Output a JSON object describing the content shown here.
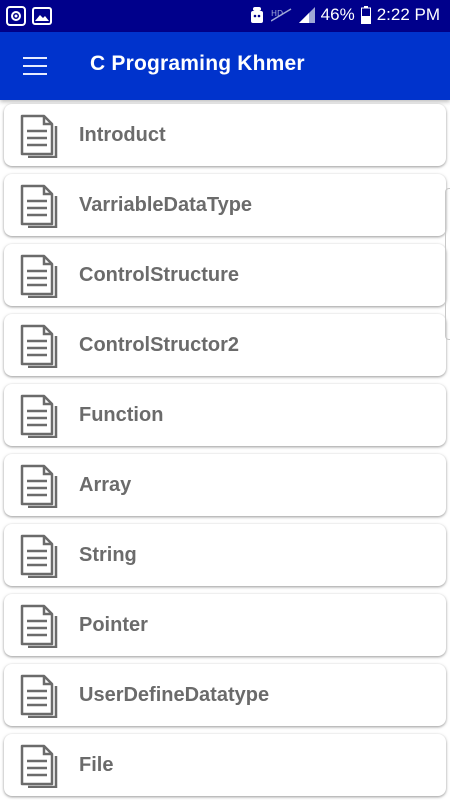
{
  "status_bar": {
    "battery": "46%",
    "time": "2:22 PM",
    "icons": [
      "gallery-icon",
      "image-icon",
      "android-icon",
      "signal-off-icon",
      "signal-icon",
      "battery-icon"
    ]
  },
  "app_bar": {
    "title": "C Programing Khmer",
    "menu_icon": "hamburger-menu-icon"
  },
  "colors": {
    "status_bar": "#00008b",
    "app_bar": "#0033cc",
    "label_text": "#6b6b6b",
    "icon": "#6b6b6b"
  },
  "items": [
    {
      "label": "Introduct",
      "icon": "document-icon"
    },
    {
      "label": "VarriableDataType",
      "icon": "document-icon"
    },
    {
      "label": "ControlStructure",
      "icon": "document-icon"
    },
    {
      "label": "ControlStructor2",
      "icon": "document-icon"
    },
    {
      "label": "Function",
      "icon": "document-icon"
    },
    {
      "label": "Array",
      "icon": "document-icon"
    },
    {
      "label": "String",
      "icon": "document-icon"
    },
    {
      "label": "Pointer",
      "icon": "document-icon"
    },
    {
      "label": "UserDefineDatatype",
      "icon": "document-icon"
    },
    {
      "label": "File",
      "icon": "document-icon"
    }
  ]
}
